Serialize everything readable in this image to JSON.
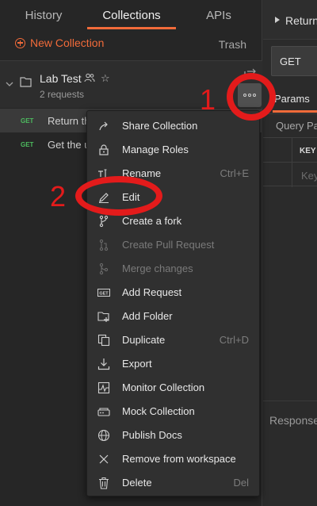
{
  "sidebar": {
    "tabs": [
      {
        "label": "History",
        "active": false
      },
      {
        "label": "Collections",
        "active": true
      },
      {
        "label": "APIs",
        "active": false
      }
    ],
    "new_collection_label": "New Collection",
    "trash_label": "Trash",
    "collection": {
      "name": "Lab Test",
      "count_label": "2 requests"
    },
    "requests": [
      {
        "method": "GET",
        "name": "Return th"
      },
      {
        "method": "GET",
        "name": "Get the u"
      }
    ]
  },
  "main": {
    "request_title": "Return",
    "method": "GET",
    "params_tab": "Params",
    "query_params_label": "Query Pa",
    "key_header": "KEY",
    "key_placeholder": "Key",
    "response_label": "Response"
  },
  "menu": {
    "items": [
      {
        "label": "Share Collection",
        "shortcut": "",
        "icon": "share-icon",
        "disabled": false
      },
      {
        "label": "Manage Roles",
        "shortcut": "",
        "icon": "lock-icon",
        "disabled": false
      },
      {
        "label": "Rename",
        "shortcut": "Ctrl+E",
        "icon": "rename-icon",
        "disabled": false
      },
      {
        "label": "Edit",
        "shortcut": "",
        "icon": "pencil-icon",
        "disabled": false
      },
      {
        "label": "Create a fork",
        "shortcut": "",
        "icon": "fork-icon",
        "disabled": false
      },
      {
        "label": "Create Pull Request",
        "shortcut": "",
        "icon": "pull-request-icon",
        "disabled": true
      },
      {
        "label": "Merge changes",
        "shortcut": "",
        "icon": "merge-icon",
        "disabled": true
      },
      {
        "label": "Add Request",
        "shortcut": "",
        "icon": "get-request-icon",
        "disabled": false
      },
      {
        "label": "Add Folder",
        "shortcut": "",
        "icon": "folder-plus-icon",
        "disabled": false
      },
      {
        "label": "Duplicate",
        "shortcut": "Ctrl+D",
        "icon": "duplicate-icon",
        "disabled": false
      },
      {
        "label": "Export",
        "shortcut": "",
        "icon": "export-icon",
        "disabled": false
      },
      {
        "label": "Monitor Collection",
        "shortcut": "",
        "icon": "monitor-icon",
        "disabled": false
      },
      {
        "label": "Mock Collection",
        "shortcut": "",
        "icon": "mock-server-icon",
        "disabled": false
      },
      {
        "label": "Publish Docs",
        "shortcut": "",
        "icon": "globe-icon",
        "disabled": false
      },
      {
        "label": "Remove from workspace",
        "shortcut": "",
        "icon": "close-icon",
        "disabled": false
      },
      {
        "label": "Delete",
        "shortcut": "Del",
        "icon": "trash-icon",
        "disabled": false
      }
    ]
  },
  "annotations": {
    "step_1": "1",
    "step_2": "2"
  },
  "colors": {
    "accent": "#f26b3a",
    "annotation": "#e31b1b",
    "get_method": "#4dbb5f"
  }
}
